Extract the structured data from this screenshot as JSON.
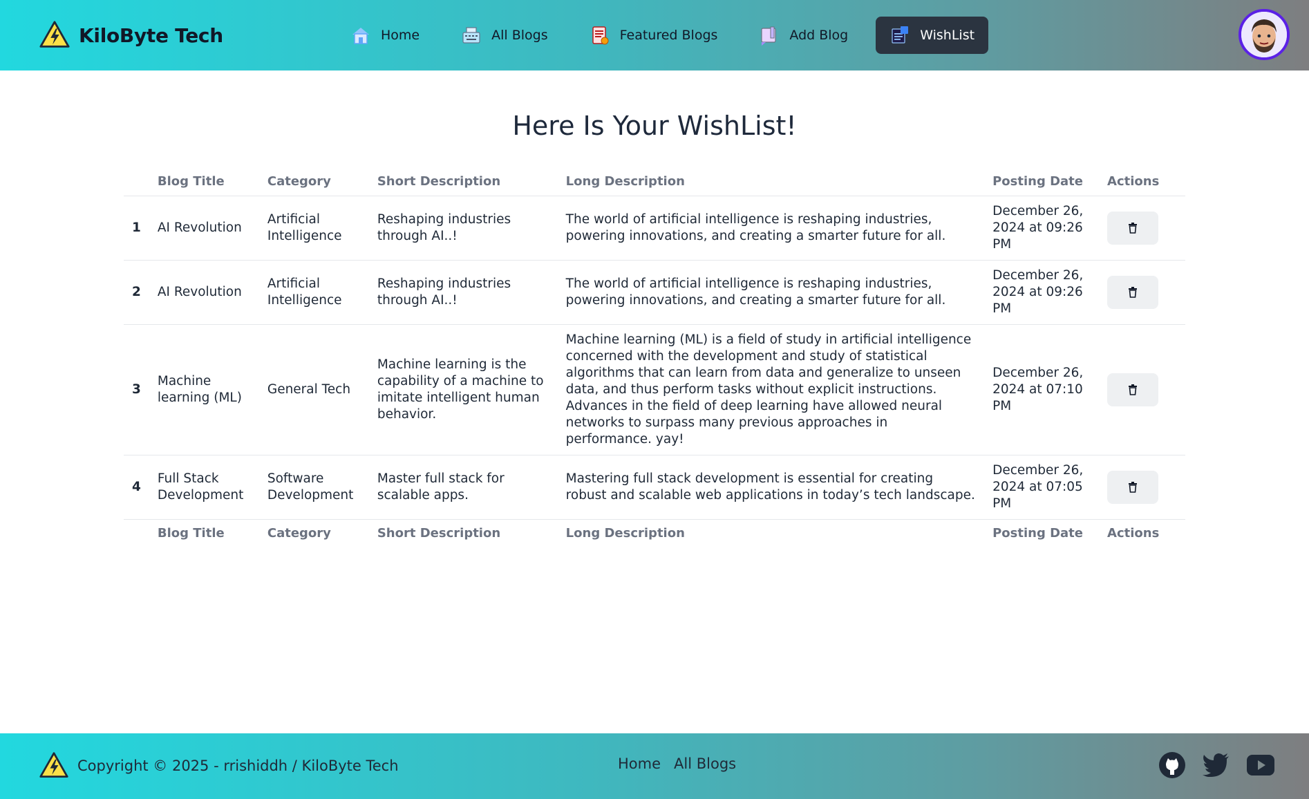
{
  "brand": {
    "name": "KiloByte Tech",
    "logo_icon": "lightning-triangle-icon"
  },
  "nav": {
    "items": [
      {
        "label": "Home",
        "icon": "home-icon",
        "active": false
      },
      {
        "label": "All Blogs",
        "icon": "typewriter-icon",
        "active": false
      },
      {
        "label": "Featured Blogs",
        "icon": "featured-list-icon",
        "active": false
      },
      {
        "label": "Add Blog",
        "icon": "add-blog-icon",
        "active": false
      },
      {
        "label": "WishList",
        "icon": "wishlist-icon",
        "active": true
      }
    ],
    "avatar_icon": "user-avatar-icon"
  },
  "main": {
    "title": "Here Is Your WishList!",
    "table": {
      "headers": [
        "Blog Title",
        "Category",
        "Short Description",
        "Long Description",
        "Posting Date",
        "Actions"
      ],
      "rows": [
        {
          "index": "1",
          "title": "AI Revolution",
          "category": "Artificial Intelligence",
          "short": "Reshaping industries through AI..!",
          "long": "The world of artificial intelligence is reshaping industries, powering innovations, and creating a smarter future for all.",
          "date": "December 26, 2024 at 09:26 PM"
        },
        {
          "index": "2",
          "title": "AI Revolution",
          "category": "Artificial Intelligence",
          "short": "Reshaping industries through AI..!",
          "long": "The world of artificial intelligence is reshaping industries, powering innovations, and creating a smarter future for all.",
          "date": "December 26, 2024 at 09:26 PM"
        },
        {
          "index": "3",
          "title": "Machine learning (ML)",
          "category": "General Tech",
          "short": "Machine learning is the capability of a machine to imitate intelligent human behavior.",
          "long": "Machine learning (ML) is a field of study in artificial intelligence concerned with the development and study of statistical algorithms that can learn from data and generalize to unseen data, and thus perform tasks without explicit instructions. Advances in the field of deep learning have allowed neural networks to surpass many previous approaches in performance. yay!",
          "date": "December 26, 2024 at 07:10 PM"
        },
        {
          "index": "4",
          "title": "Full Stack Development",
          "category": "Software Development",
          "short": "Master full stack for scalable apps.",
          "long": "Mastering full stack development is essential for creating robust and scalable web applications in today’s tech landscape.",
          "date": "December 26, 2024 at 07:05 PM"
        }
      ],
      "delete_icon": "trash-icon"
    }
  },
  "footer": {
    "copyright": "Copyright © 2025 - rrishiddh / KiloByte Tech",
    "links": [
      "Home",
      "All Blogs"
    ],
    "socials": [
      "github-icon",
      "twitter-icon",
      "youtube-icon"
    ]
  },
  "colors": {
    "gradient_start": "#22d8df",
    "gradient_end": "#7e7e80",
    "active_nav_bg": "#2b3440",
    "avatar_ring": "#5b21e6"
  }
}
